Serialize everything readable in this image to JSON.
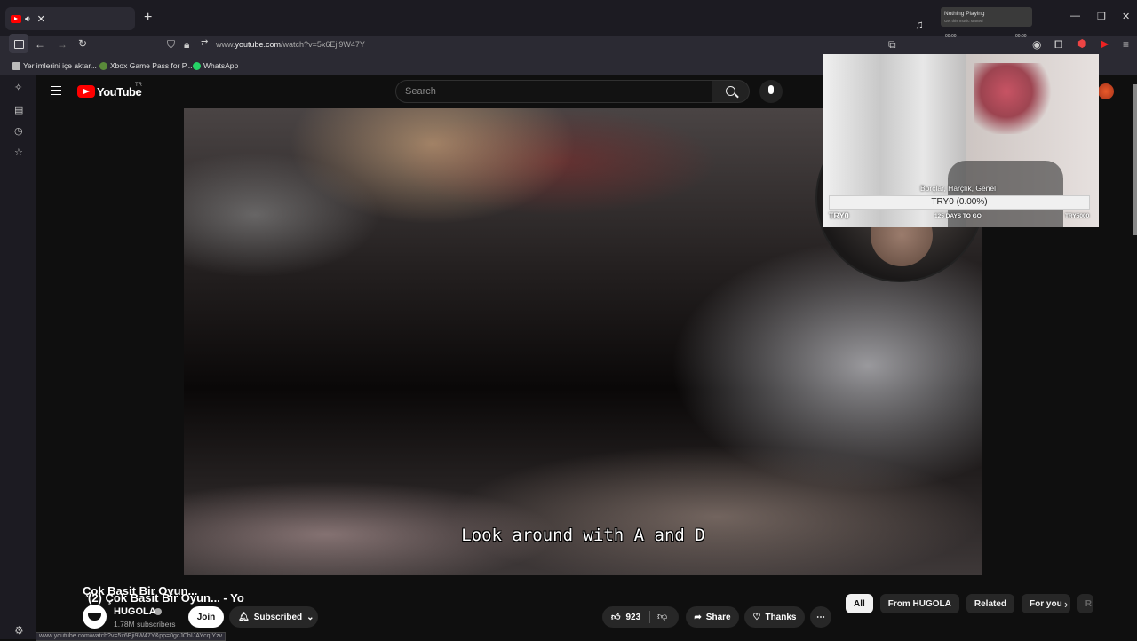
{
  "browser": {
    "tab_title": "(2) Çok Basit Bir Oyun... - Yo",
    "tab_close": "✕",
    "new_tab": "+",
    "url_prefix": "www.",
    "url_domain": "youtube.com",
    "url_path": "/watch?v=5x6Eji9W47Y",
    "bookmarks": [
      "Yer imlerini içe aktar...",
      "Xbox Game Pass for P...",
      "WhatsApp"
    ],
    "status_url": "www.youtube.com/watch?v=5x6Eji9W47Y&pp=0gcJCbIJAYcqIYzv"
  },
  "music_widget": {
    "title": "Nothing Playing",
    "subtitle": "Get this music started",
    "time_start": "00:00",
    "time_end": "00:00"
  },
  "youtube": {
    "logo_text": "YouTube",
    "region": "TR",
    "search_placeholder": "Search"
  },
  "video": {
    "subtitle_text": "Look around with A and D",
    "title": "Çok Basit Bir Oyun..."
  },
  "stream_overlay": {
    "goal_title": "Borçlar, Harçlık, Genel",
    "goal_progress": "TRY0 (0.00%)",
    "goal_current": "TRY0",
    "days_left": "125 DAYS TO GO",
    "goal_target": "TRY5000"
  },
  "channel": {
    "name": "HUGOLA",
    "subscribers": "1.78M subscribers",
    "join_label": "Join",
    "subscribed_label": "Subscribed"
  },
  "actions": {
    "likes": "923",
    "share_label": "Share",
    "thanks_label": "Thanks"
  },
  "chips": [
    "All",
    "From HUGOLA",
    "Related",
    "For you",
    "R"
  ]
}
